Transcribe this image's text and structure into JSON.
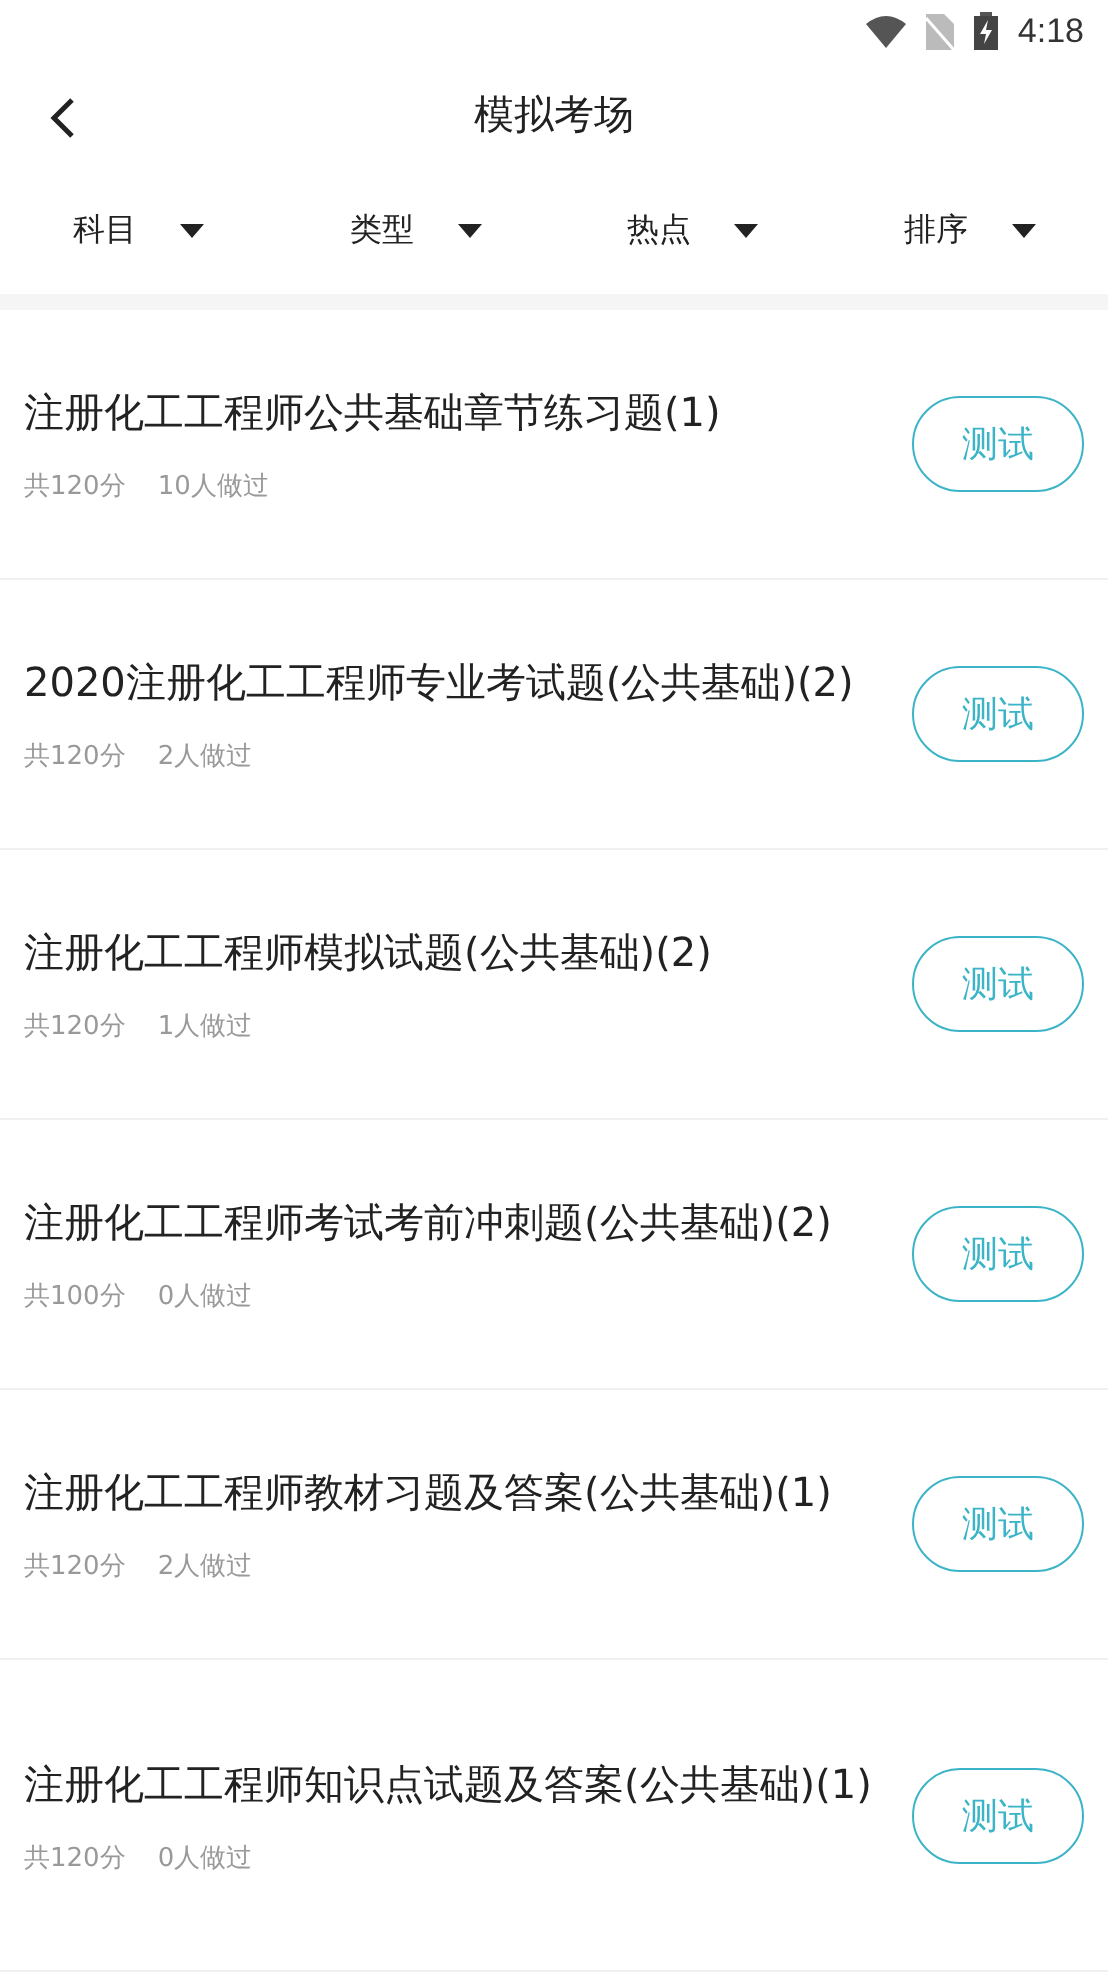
{
  "status_bar": {
    "time": "4:18"
  },
  "header": {
    "title": "模拟考场"
  },
  "filters": [
    {
      "label": "科目"
    },
    {
      "label": "类型"
    },
    {
      "label": "热点"
    },
    {
      "label": "排序"
    }
  ],
  "exams": [
    {
      "title": "注册化工工程师公共基础章节练习题(1)",
      "score": "共120分",
      "takers": "10人做过",
      "button": "测试"
    },
    {
      "title": "2020注册化工工程师专业考试题(公共基础)(2)",
      "score": "共120分",
      "takers": "2人做过",
      "button": "测试"
    },
    {
      "title": "注册化工工程师模拟试题(公共基础)(2)",
      "score": "共120分",
      "takers": "1人做过",
      "button": "测试"
    },
    {
      "title": "注册化工工程师考试考前冲刺题(公共基础)(2)",
      "score": "共100分",
      "takers": "0人做过",
      "button": "测试"
    },
    {
      "title": "注册化工工程师教材习题及答案(公共基础)(1)",
      "score": "共120分",
      "takers": "2人做过",
      "button": "测试"
    },
    {
      "title": "注册化工工程师知识点试题及答案(公共基础)(1)",
      "score": "共120分",
      "takers": "0人做过",
      "button": "测试"
    }
  ]
}
